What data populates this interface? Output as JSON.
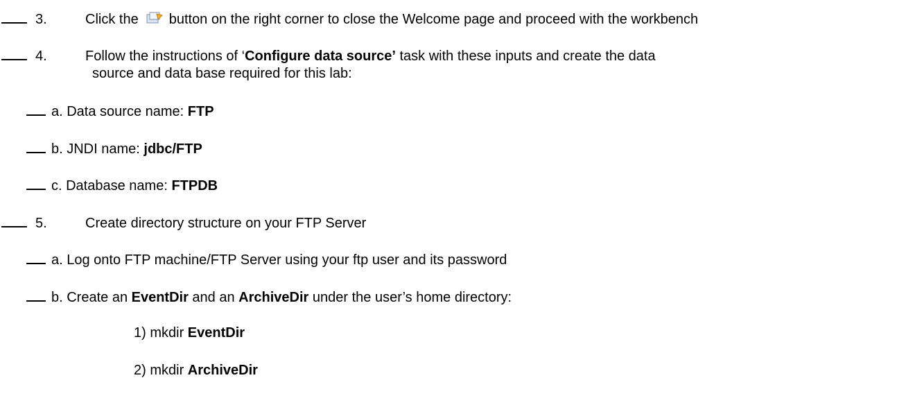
{
  "steps": [
    {
      "number": "3.",
      "text_before": "Click the",
      "icon": "restore-view-icon",
      "text_after": "button on the right corner to close the Welcome page and proceed with the workbench"
    },
    {
      "number": "4.",
      "line1_before": "Follow the instructions of ‘",
      "line1_bold": "Configure data source’",
      "line1_after": " task with these inputs and create the data",
      "line2": "source and data base required for this lab:",
      "substeps": [
        {
          "prefix": "a. Data source name: ",
          "bold": "FTP"
        },
        {
          "prefix": "b. JNDI name: ",
          "bold": "jdbc/FTP"
        },
        {
          "prefix": "c. Database name: ",
          "bold": "FTPDB"
        }
      ]
    },
    {
      "number": "5.",
      "text": "Create directory structure on your FTP Server",
      "substeps": [
        {
          "text": "a. Log onto FTP machine/FTP Server using your ftp user and its password"
        },
        {
          "p1": "b. Create an ",
          "b1": "EventDir",
          "p2": " and an ",
          "b2": "ArchiveDir",
          "p3": " under the user’s home directory:"
        }
      ],
      "commands": [
        {
          "prefix": "1) mkdir ",
          "bold": "EventDir"
        },
        {
          "prefix": "2) mkdir ",
          "bold": "ArchiveDir"
        }
      ]
    }
  ]
}
